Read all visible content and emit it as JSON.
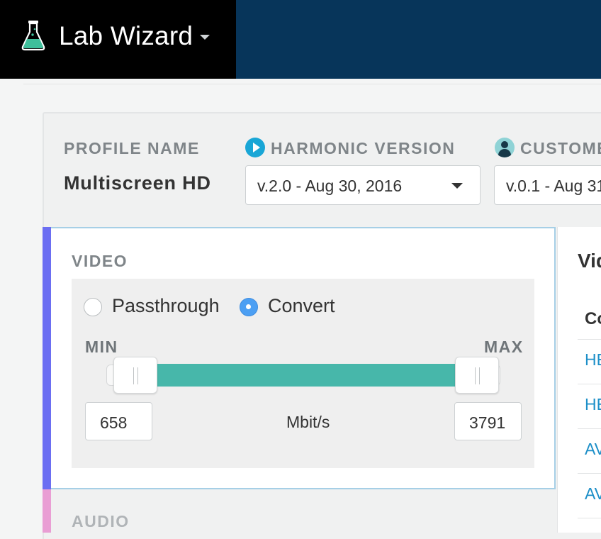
{
  "header": {
    "app_title": "Lab Wizard",
    "logo_icon": "flask-icon",
    "menu_icon": "caret-down-icon",
    "colors": {
      "topbar": "#07355a",
      "brand_bg": "#000000",
      "flask": "#3fbf9b"
    }
  },
  "profile": {
    "name_label": "PROFILE NAME",
    "name_value": "Multiscreen HD",
    "harmonic_label": "HARMONIC VERSION",
    "harmonic_icon": "play-circle-icon",
    "harmonic_value": "v.2.0 - Aug 30, 2016",
    "customer_label": "CUSTOME",
    "customer_icon": "user-circle-icon",
    "customer_value": "v.0.1 - Aug 31"
  },
  "video": {
    "section_label": "VIDEO",
    "mode_options": [
      "Passthrough",
      "Convert"
    ],
    "selected_mode": "Convert",
    "min_label": "MIN",
    "max_label": "MAX",
    "min_value": "658",
    "max_value": "3791",
    "unit": "Mbit/s",
    "accent_color": "#6b6ef2",
    "range_color": "#47b7aa"
  },
  "audio": {
    "section_label": "AUDIO",
    "accent_color": "#e99ed4"
  },
  "right_panel": {
    "title": "Vid",
    "column_header": "Co",
    "rows": [
      "HE",
      "HE",
      "AV",
      "AV"
    ]
  }
}
